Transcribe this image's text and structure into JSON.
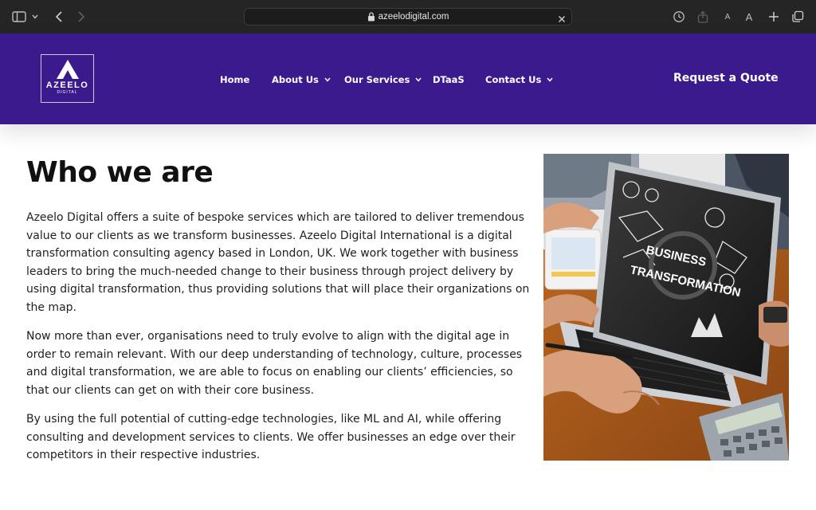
{
  "browser": {
    "url": "azeelodigital.com",
    "text_size_small": "A",
    "text_size_large": "A"
  },
  "header": {
    "logo_word": "AZEELO",
    "logo_sub": "DIGITAL",
    "nav": [
      {
        "label": "Home",
        "has_dropdown": false
      },
      {
        "label": "About Us",
        "has_dropdown": true
      },
      {
        "label": "Our Services",
        "has_dropdown": true
      },
      {
        "label": "DTaaS",
        "has_dropdown": false
      },
      {
        "label": "Contact Us",
        "has_dropdown": true
      }
    ],
    "cta": "Request a Quote",
    "background_color": "#3a1a8c"
  },
  "main": {
    "title": "Who we are",
    "paragraphs": [
      "Azeelo Digital offers a suite of bespoke services which are tailored to deliver tremendous value to our clients as we transform businesses. Azeelo Digital International is a digital transformation consulting agency based in London, UK. We work together with business leaders to bring the much-needed change to their business through project delivery by using digital transformation, thus providing solutions that will place their organizations on the map.",
      "Now more than ever, organisations need to truly evolve to align with the digital age in order to remain relevant. With our deep understanding of technology, culture, processes and digital transformation, we are able to focus on enabling our clients’ efficiencies, so that our clients can get on with their core business.",
      "By using the full potential of cutting-edge technologies, like ML and AI, while offering consulting and development services to clients. We offer businesses an edge over their competitors in their respective industries."
    ],
    "image": {
      "screen_text_line1": "BUSINESS",
      "screen_text_line2": "TRANSFORMATION"
    }
  }
}
